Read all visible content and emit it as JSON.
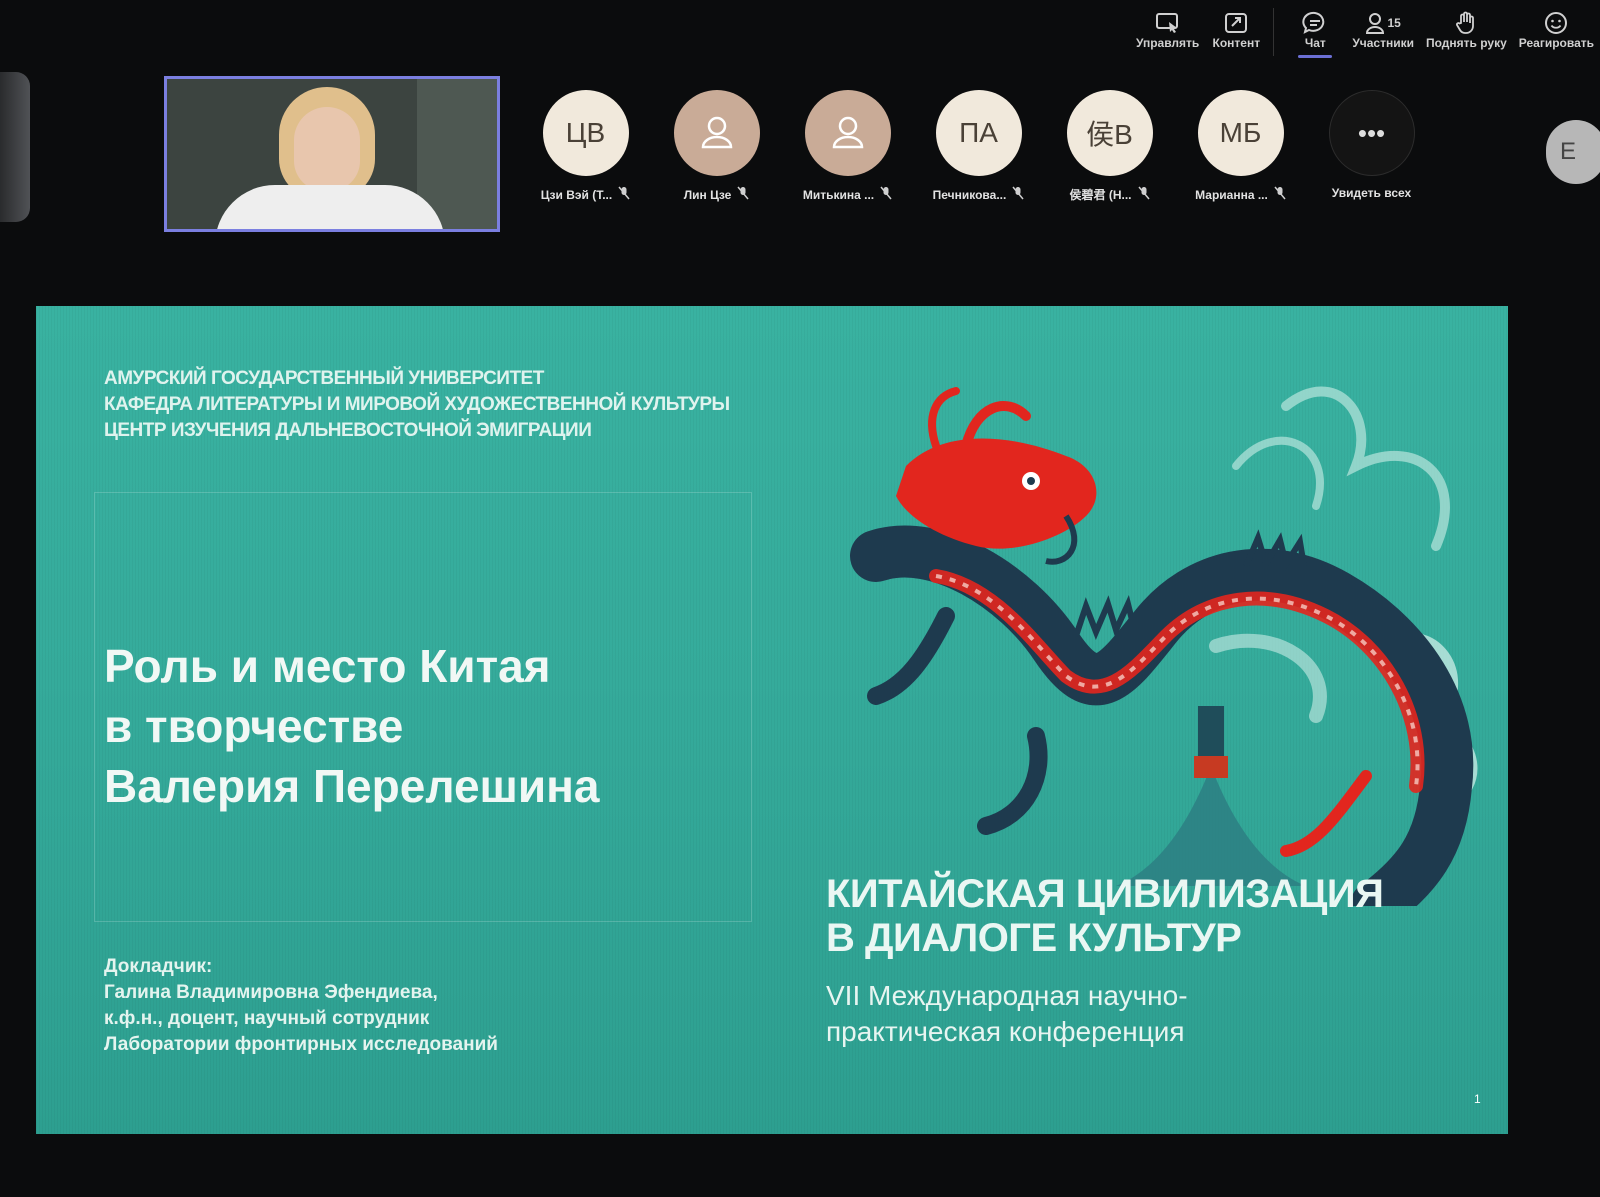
{
  "toolbar": {
    "manage": "Управлять",
    "content": "Контент",
    "chat": "Чат",
    "participants": "Участники",
    "participants_count": "15",
    "raise_hand": "Поднять руку",
    "react": "Реагировать"
  },
  "participants": [
    {
      "initials": "ЦВ",
      "name": "Цзи Вэй (Т...",
      "type": "initials"
    },
    {
      "initials": "",
      "name": "Лин Цзе",
      "type": "generic"
    },
    {
      "initials": "",
      "name": "Митькина ...",
      "type": "generic"
    },
    {
      "initials": "ПА",
      "name": "Печникова...",
      "type": "initials"
    },
    {
      "initials": "侯В",
      "name": "侯碧君 (Н...",
      "type": "initials"
    },
    {
      "initials": "МБ",
      "name": "Марианна ...",
      "type": "initials"
    }
  ],
  "see_all": {
    "icon": "•••",
    "label": "Увидеть всех"
  },
  "right_avatar": "Е",
  "slide": {
    "org_lines": [
      "АМУРСКИЙ ГОСУДАРСТВЕННЫЙ УНИВЕРСИТЕТ",
      "КАФЕДРА  ЛИТЕРАТУРЫ И МИРОВОЙ ХУДОЖЕСТВЕННОЙ КУЛЬТУРЫ",
      "ЦЕНТР ИЗУЧЕНИЯ ДАЛЬНЕВОСТОЧНОЙ ЭМИГРАЦИИ"
    ],
    "title_lines": [
      "Роль и место Китая",
      "в творчестве",
      "Валерия Перелешина"
    ],
    "speaker_lines": [
      "Докладчик:",
      "Галина Владимировна Эфендиева,",
      "к.ф.н., доцент, научный сотрудник",
      "Лаборатории фронтирных исследований"
    ],
    "conference_lines": [
      "КИТАЙСКАЯ ЦИВИЛИЗАЦИЯ",
      "В ДИАЛОГЕ КУЛЬТУР"
    ],
    "conference_sub_lines": [
      "VII Международная научно-",
      "практическая конференция"
    ],
    "page_number": "1"
  },
  "colors": {
    "slide_bg": "#36ad9d",
    "active_accent": "#7b7fe0",
    "dragon_red": "#e2261e",
    "dragon_dark": "#1e3a4e"
  }
}
